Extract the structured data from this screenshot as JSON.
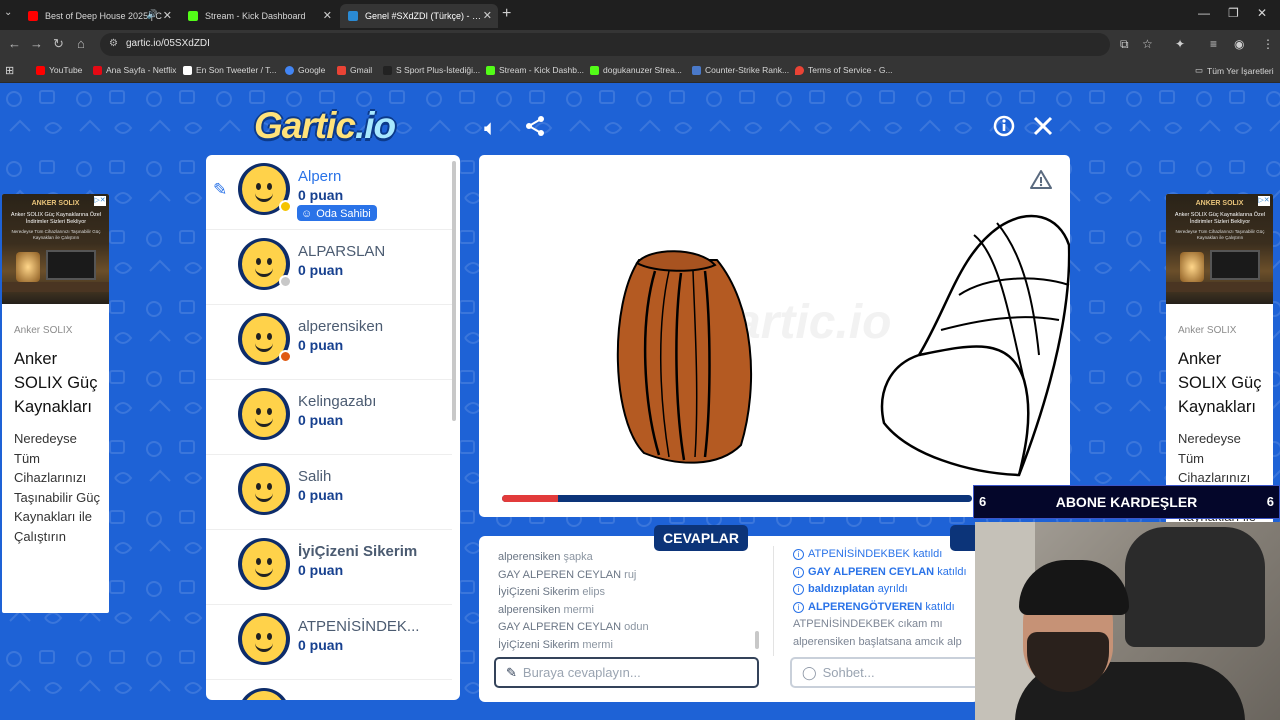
{
  "browser": {
    "tabs": [
      {
        "title": "Best of Deep House 2025 | C",
        "color": "#ff0000"
      },
      {
        "title": "Stream - Kick Dashboard",
        "color": "#53fc18"
      },
      {
        "title": "Genel #SXdZDI (Türkçe) - Gartic",
        "color": "#2a8ad4"
      }
    ],
    "url": "gartic.io/05SXdZDI",
    "bookmarks": [
      {
        "label": "YouTube",
        "color": "#ff0000"
      },
      {
        "label": "Ana Sayfa - Netflix",
        "color": "#e50914"
      },
      {
        "label": "En Son Tweetler / T...",
        "color": "#ffffff"
      },
      {
        "label": "Google",
        "color": "#4285f4"
      },
      {
        "label": "Gmail",
        "color": "#ea4335"
      },
      {
        "label": "S Sport Plus-İstediği...",
        "color": "#222222"
      },
      {
        "label": "Stream - Kick Dashb...",
        "color": "#53fc18"
      },
      {
        "label": "dogukanuzer Strea...",
        "color": "#53fc18"
      },
      {
        "label": "Counter-Strike Rank...",
        "color": "#4a79c9"
      },
      {
        "label": "Terms of Service - G...",
        "color": "#ea4335"
      }
    ],
    "all_bookmarks": "Tüm Yer İşaretleri"
  },
  "game": {
    "logo_main": "Gartic",
    "logo_suffix": ".io",
    "canvas_watermark": "artic.io",
    "round_progress": 0.12,
    "players": [
      {
        "name": "Alpern",
        "score": "0 puan",
        "dot": "#f5c400",
        "drawing": true,
        "owner": "Oda Sahibi"
      },
      {
        "name": "ALPARSLAN",
        "score": "0 puan",
        "dot": "#c8c8c8"
      },
      {
        "name": "alperensiken",
        "score": "0 puan",
        "dot": "#e05a12"
      },
      {
        "name": "Kelingazabı",
        "score": "0 puan",
        "dot": ""
      },
      {
        "name": "Salih",
        "score": "0 puan",
        "dot": ""
      },
      {
        "name": "İyiÇizeni Sikerim",
        "score": "0 puan",
        "dot": ""
      },
      {
        "name": "ATPENİSİNDEK...",
        "score": "0 puan",
        "dot": ""
      }
    ],
    "answers_tab": "CEVAPLAR",
    "answers": [
      {
        "name": "alperensiken",
        "text": "şapka"
      },
      {
        "name": "GAY ALPEREN CEYLAN",
        "text": "ruj"
      },
      {
        "name": "İyiÇizeni Sikerim",
        "text": "elips"
      },
      {
        "name": "alperensiken",
        "text": "mermi"
      },
      {
        "name": "GAY ALPEREN CEYLAN",
        "text": "odun"
      },
      {
        "name": "İyiÇizeni Sikerim",
        "text": "mermi"
      }
    ],
    "chat": [
      {
        "name": "ATPENİSİNDEKBEK",
        "text": "katıldı",
        "info": true
      },
      {
        "name": "GAY ALPEREN CEYLAN",
        "text": "katıldı",
        "info": true
      },
      {
        "name": "baldızıplatan",
        "text": "ayrıldı",
        "info": true
      },
      {
        "name": "ALPERENGÖTVEREN",
        "text": "katıldı",
        "info": true
      },
      {
        "name": "ATPENİSİNDEKBEK",
        "text": "cıkam mı",
        "info": false
      },
      {
        "name": "alperensiken",
        "text": "başlatsana amcık alp",
        "info": false
      }
    ],
    "answer_placeholder": "Buraya cevaplayın...",
    "chat_placeholder": "Sohbet..."
  },
  "ads": {
    "brand": "ANKER SOLIX",
    "img_headline": "Anker SOLIX Güç Kaynaklarına Özel İndirimler Sizleri Bekliyor",
    "img_sub": "Neredeyse Tüm Cihazlarınızı Taşınabilir Güç Kaynakları ile Çalıştırın",
    "source": "Anker SOLIX",
    "title": "Anker SOLIX Güç Kaynakları",
    "body": "Neredeyse Tüm Cihazlarınızı Taşınabilir Güç Kaynakları ile Çalıştırın"
  },
  "overlay": {
    "banner": "ABONE KARDEŞLER",
    "banner_num": "6"
  }
}
